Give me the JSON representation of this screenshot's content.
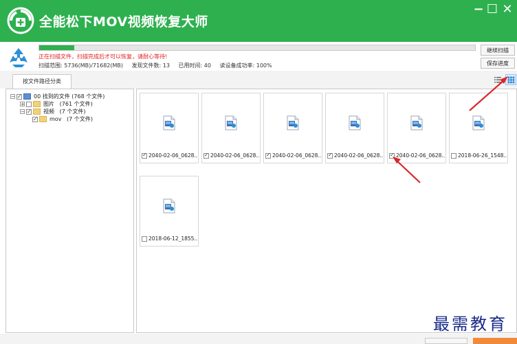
{
  "app": {
    "title": "全能松下MOV视频恢复大师"
  },
  "window_controls": {
    "minimize": "−",
    "maximize": "☐",
    "close": "✕"
  },
  "scan": {
    "progress_fraction": 0.08,
    "warning": "正在扫描文件，扫描完成后才可以恢复，请耐心等待!",
    "range": "扫描范围: 5736(MB)/71682(MB)",
    "found": "发现文件数: 13",
    "elapsed": "已用时间: 40",
    "health": "读设备成功率: 100%",
    "continue_label": "继续扫描",
    "save_label": "保存进度"
  },
  "tabs": {
    "by_path": "按文件路径分类"
  },
  "tree": {
    "root": "00 找到的文件 (768 个文件)",
    "items": [
      {
        "label": "图片",
        "count": "(761 个文件)",
        "checked": false
      },
      {
        "label": "视频",
        "count": "(7 个文件)",
        "checked": true
      },
      {
        "label": "mov",
        "count": "(7 个文件)",
        "checked": true
      }
    ]
  },
  "files": [
    {
      "name": "2040-02-06_0628...",
      "checked": true
    },
    {
      "name": "2040-02-06_0628...",
      "checked": true
    },
    {
      "name": "2040-02-06_0628...",
      "checked": true
    },
    {
      "name": "2040-02-06_0628...",
      "checked": true
    },
    {
      "name": "2040-02-06_0628...",
      "checked": true
    },
    {
      "name": "2018-06-26_1548...",
      "checked": false
    },
    {
      "name": "2018-06-12_1855...",
      "checked": false
    }
  ],
  "watermark": "最需教育",
  "colors": {
    "brand": "#2eb04f",
    "warning": "#e02020",
    "annotation": "#d9262b"
  }
}
